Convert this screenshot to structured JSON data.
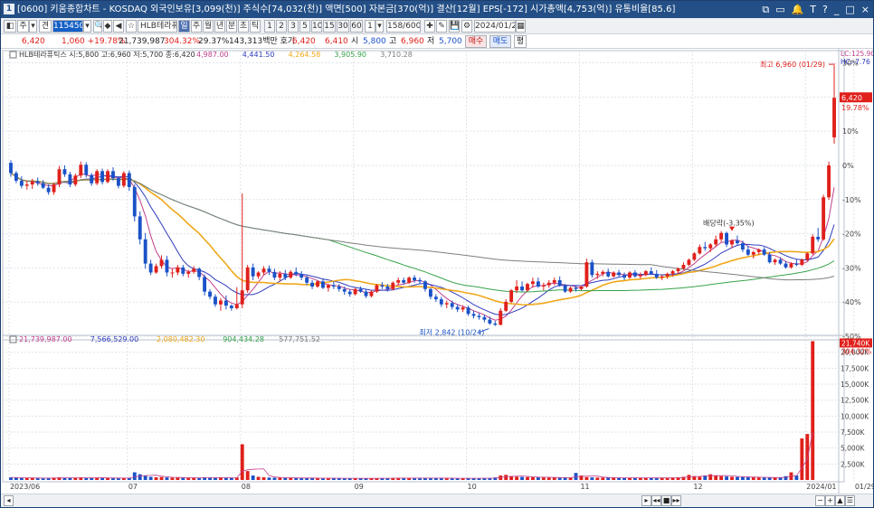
{
  "window": {
    "number": "1",
    "title": "[0600] 키움종합차트 - KOSDAQ 외국인보유[3,099(천)] 주식수[74,032(천)] 액면[500] 자본금[370(억)] 결산[12월] EPS[-172] 시가총액[4,753(억)] 유통비율[85.6]",
    "controls": [
      "⧉",
      "▭",
      "🔔",
      "T",
      "?",
      "_",
      "□",
      "×"
    ]
  },
  "toolbar": {
    "toggle": "◧",
    "market": "주",
    "dropdown": "▾",
    "search_type": "견",
    "stock_code": "115450",
    "search_icon": "🔍",
    "lock_icon": "◆",
    "prev_icon": "◀",
    "star_icon": "☆",
    "stock_name": "HLB테라퓨",
    "periods": [
      "일",
      "주",
      "월",
      "년",
      "분",
      "초",
      "틱"
    ],
    "intervals": [
      "1",
      "2",
      "3",
      "5",
      "10",
      "15",
      "30",
      "60"
    ],
    "interval_value": "1",
    "count": "158/600",
    "tool_icons": [
      "✚",
      "✎",
      "💾",
      "⚙"
    ],
    "date": "2024/01/29",
    "calendar_icon": "▦"
  },
  "quote": {
    "price": "6,420",
    "change": "1,060 +19.78%",
    "volume": "21,739,987",
    "volume_ratio": "304.32%",
    "turnover": "29.37%",
    "trading_value": "143,313백만 호가",
    "ask": "6,420",
    "bid": "6,410",
    "open_label": "시",
    "open": "5,800",
    "high_label": "고",
    "high": "6,960",
    "low_label": "저",
    "low": "5,700",
    "buy_label": "매수",
    "sell_label": "매도",
    "equal_label": "평"
  },
  "legend": {
    "price": "HLB테라퓨틱스 시:5,800 고:6,960 저:5,700 종:6,420",
    "ma_values": [
      "4,987.00",
      "4,441.50",
      "4,264.58",
      "3,905.90",
      "3,710.28"
    ],
    "volume_values": [
      "21,739,987.00",
      "7,566,529.00",
      "2,080,482.30",
      "904,434.28",
      "577,751.52"
    ]
  },
  "colors": {
    "up": "#e0201b",
    "down": "#1a52c8",
    "ma5": "#c0408c",
    "ma10": "#2f3cbf",
    "ma20": "#f0a81b",
    "ma60": "#36a34a",
    "ma120": "#7e7e7e",
    "grid": "#dde3ea",
    "window": "#234f86"
  },
  "axis": {
    "corner_top": "LC:125.90",
    "corner_sub": "HC:-7.76",
    "price_flag": "6,420",
    "price_flag_pct": "19.78%",
    "vol_flag": "21,740K",
    "vol_flag_pct": "304.32%"
  },
  "annotations": {
    "high": "최고 6,960 (01/29)",
    "low": "최저 2,842 (10/24)",
    "ex_dividend": "배당락(-3.35%)"
  },
  "bottom": {
    "scroll_left": "◂",
    "nav": [
      "▸",
      "◂◂",
      "■",
      "▸▸"
    ],
    "zoom": [
      "−",
      "+",
      "▲",
      "☰"
    ],
    "last_date": "01/29"
  },
  "chart_data": {
    "type": "candlestick",
    "price_axis": {
      "labels": [
        "30%",
        "20%",
        "10%",
        "0%",
        "-10%",
        "-20%",
        "-30%",
        "-40%",
        "-50%"
      ],
      "values": [
        30,
        20,
        10,
        0,
        -10,
        -20,
        -30,
        -40,
        -50
      ],
      "reference_price": 5360
    },
    "volume_axis": {
      "labels": [
        "20,000K",
        "17,500K",
        "15,000K",
        "12,500K",
        "10,000K",
        "7,500K",
        "5,000K",
        "2,500K"
      ],
      "values": [
        20000,
        17500,
        15000,
        12500,
        10000,
        7500,
        5000,
        2500
      ],
      "unit": "K"
    },
    "date_labels": [
      "2023/06",
      "07",
      "08",
      "09",
      "10",
      "11",
      "12",
      "2024/01",
      "01/29"
    ],
    "date_label_index": [
      0,
      22,
      43,
      64,
      85,
      106,
      127,
      148,
      157
    ],
    "candles": [
      [
        5400,
        5440,
        5180,
        5240
      ],
      [
        5240,
        5270,
        5080,
        5120
      ],
      [
        5120,
        5190,
        5000,
        5040
      ],
      [
        5040,
        5120,
        4980,
        5060
      ],
      [
        5060,
        5150,
        4990,
        5110
      ],
      [
        5110,
        5170,
        5040,
        5080
      ],
      [
        5080,
        5130,
        4990,
        5010
      ],
      [
        5010,
        5060,
        4900,
        4940
      ],
      [
        4940,
        5090,
        4900,
        5060
      ],
      [
        5060,
        5350,
        5020,
        5300
      ],
      [
        5300,
        5360,
        5180,
        5220
      ],
      [
        5220,
        5260,
        5020,
        5060
      ],
      [
        5060,
        5230,
        5030,
        5200
      ],
      [
        5200,
        5420,
        5160,
        5370
      ],
      [
        5370,
        5410,
        5170,
        5210
      ],
      [
        5210,
        5240,
        5040,
        5080
      ],
      [
        5080,
        5300,
        5050,
        5270
      ],
      [
        5270,
        5310,
        5060,
        5100
      ],
      [
        5100,
        5300,
        5080,
        5270
      ],
      [
        5270,
        5330,
        5120,
        5160
      ],
      [
        5160,
        5190,
        5000,
        5040
      ],
      [
        5040,
        5270,
        5010,
        5240
      ],
      [
        5240,
        5280,
        4960,
        5020
      ],
      [
        5020,
        5060,
        4480,
        4560
      ],
      [
        4560,
        4640,
        4120,
        4200
      ],
      [
        4200,
        4300,
        3740,
        3820
      ],
      [
        3820,
        3880,
        3640,
        3680
      ],
      [
        3680,
        3820,
        3660,
        3780
      ],
      [
        3780,
        3950,
        3740,
        3880
      ],
      [
        3880,
        3940,
        3620,
        3680
      ],
      [
        3680,
        3740,
        3600,
        3680
      ],
      [
        3680,
        3800,
        3640,
        3760
      ],
      [
        3760,
        3800,
        3620,
        3660
      ],
      [
        3660,
        3720,
        3600,
        3690
      ],
      [
        3690,
        3780,
        3660,
        3740
      ],
      [
        3740,
        3760,
        3560,
        3610
      ],
      [
        3610,
        3650,
        3320,
        3380
      ],
      [
        3380,
        3420,
        3260,
        3300
      ],
      [
        3300,
        3340,
        3140,
        3180
      ],
      [
        3180,
        3280,
        3080,
        3240
      ],
      [
        3240,
        3320,
        3100,
        3160
      ],
      [
        3160,
        3180,
        3080,
        3120
      ],
      [
        3120,
        3450,
        3100,
        3180
      ],
      [
        3180,
        4920,
        3120,
        3400
      ],
      [
        3400,
        3800,
        3360,
        3760
      ],
      [
        3760,
        3820,
        3560,
        3620
      ],
      [
        3620,
        3700,
        3580,
        3680
      ],
      [
        3680,
        3780,
        3640,
        3740
      ],
      [
        3740,
        3790,
        3640,
        3690
      ],
      [
        3690,
        3740,
        3560,
        3600
      ],
      [
        3600,
        3700,
        3540,
        3660
      ],
      [
        3660,
        3720,
        3560,
        3600
      ],
      [
        3600,
        3720,
        3580,
        3690
      ],
      [
        3690,
        3760,
        3620,
        3650
      ],
      [
        3650,
        3700,
        3560,
        3600
      ],
      [
        3600,
        3630,
        3480,
        3520
      ],
      [
        3520,
        3560,
        3420,
        3460
      ],
      [
        3460,
        3560,
        3440,
        3540
      ],
      [
        3540,
        3590,
        3420,
        3440
      ],
      [
        3440,
        3500,
        3380,
        3480
      ],
      [
        3480,
        3540,
        3420,
        3460
      ],
      [
        3460,
        3500,
        3380,
        3420
      ],
      [
        3420,
        3460,
        3330,
        3380
      ],
      [
        3380,
        3420,
        3300,
        3340
      ],
      [
        3340,
        3440,
        3320,
        3420
      ],
      [
        3420,
        3460,
        3360,
        3380
      ],
      [
        3380,
        3410,
        3280,
        3310
      ],
      [
        3310,
        3400,
        3290,
        3380
      ],
      [
        3380,
        3500,
        3360,
        3480
      ],
      [
        3480,
        3530,
        3420,
        3460
      ],
      [
        3460,
        3500,
        3380,
        3420
      ],
      [
        3420,
        3540,
        3400,
        3520
      ],
      [
        3520,
        3600,
        3480,
        3560
      ],
      [
        3560,
        3600,
        3490,
        3520
      ],
      [
        3520,
        3620,
        3500,
        3600
      ],
      [
        3600,
        3640,
        3520,
        3560
      ],
      [
        3560,
        3600,
        3500,
        3540
      ],
      [
        3540,
        3560,
        3380,
        3420
      ],
      [
        3420,
        3440,
        3260,
        3300
      ],
      [
        3300,
        3340,
        3220,
        3260
      ],
      [
        3260,
        3300,
        3140,
        3180
      ],
      [
        3180,
        3240,
        3120,
        3200
      ],
      [
        3200,
        3240,
        3100,
        3140
      ],
      [
        3140,
        3180,
        3060,
        3100
      ],
      [
        3100,
        3160,
        3060,
        3130
      ],
      [
        3130,
        3160,
        3000,
        3030
      ],
      [
        3030,
        3080,
        2960,
        3000
      ],
      [
        3000,
        3040,
        2940,
        2980
      ],
      [
        2980,
        3020,
        2900,
        2940
      ],
      [
        2940,
        2990,
        2860,
        2880
      ],
      [
        2880,
        2920,
        2842,
        2860
      ],
      [
        2860,
        3120,
        2850,
        3080
      ],
      [
        3080,
        3260,
        3060,
        3220
      ],
      [
        3220,
        3420,
        3200,
        3400
      ],
      [
        3400,
        3560,
        3360,
        3460
      ],
      [
        3460,
        3540,
        3380,
        3400
      ],
      [
        3400,
        3520,
        3380,
        3500
      ],
      [
        3500,
        3600,
        3440,
        3540
      ],
      [
        3540,
        3600,
        3440,
        3460
      ],
      [
        3460,
        3520,
        3400,
        3480
      ],
      [
        3480,
        3560,
        3440,
        3520
      ],
      [
        3520,
        3600,
        3480,
        3560
      ],
      [
        3560,
        3620,
        3460,
        3480
      ],
      [
        3480,
        3500,
        3360,
        3380
      ],
      [
        3380,
        3460,
        3360,
        3440
      ],
      [
        3440,
        3480,
        3380,
        3420
      ],
      [
        3420,
        3480,
        3400,
        3460
      ],
      [
        3460,
        3900,
        3440,
        3840
      ],
      [
        3840,
        3880,
        3600,
        3640
      ],
      [
        3640,
        3700,
        3580,
        3660
      ],
      [
        3660,
        3720,
        3620,
        3690
      ],
      [
        3690,
        3740,
        3600,
        3620
      ],
      [
        3620,
        3700,
        3600,
        3680
      ],
      [
        3680,
        3720,
        3620,
        3640
      ],
      [
        3640,
        3680,
        3560,
        3600
      ],
      [
        3600,
        3700,
        3580,
        3680
      ],
      [
        3680,
        3720,
        3600,
        3620
      ],
      [
        3620,
        3680,
        3580,
        3640
      ],
      [
        3640,
        3720,
        3620,
        3700
      ],
      [
        3700,
        3760,
        3640,
        3660
      ],
      [
        3660,
        3720,
        3580,
        3600
      ],
      [
        3600,
        3640,
        3560,
        3620
      ],
      [
        3620,
        3680,
        3580,
        3660
      ],
      [
        3660,
        3720,
        3620,
        3700
      ],
      [
        3700,
        3760,
        3660,
        3740
      ],
      [
        3740,
        3840,
        3720,
        3800
      ],
      [
        3800,
        3900,
        3780,
        3880
      ],
      [
        3880,
        4000,
        3860,
        3980
      ],
      [
        3980,
        4120,
        3960,
        4080
      ],
      [
        4080,
        4160,
        4020,
        4060
      ],
      [
        4060,
        4140,
        4000,
        4120
      ],
      [
        4120,
        4260,
        4080,
        4200
      ],
      [
        4200,
        4330,
        4160,
        4300
      ],
      [
        4300,
        4320,
        4080,
        4120
      ],
      [
        4120,
        4200,
        4060,
        4180
      ],
      [
        4180,
        4260,
        4100,
        4140
      ],
      [
        4140,
        4180,
        4000,
        4040
      ],
      [
        4040,
        4100,
        3940,
        3960
      ],
      [
        3960,
        4020,
        3900,
        4000
      ],
      [
        4000,
        4060,
        3960,
        4040
      ],
      [
        4040,
        4080,
        3940,
        3960
      ],
      [
        3960,
        4000,
        3820,
        3840
      ],
      [
        3840,
        3900,
        3800,
        3880
      ],
      [
        3880,
        3920,
        3800,
        3820
      ],
      [
        3820,
        3860,
        3740,
        3760
      ],
      [
        3760,
        3840,
        3740,
        3820
      ],
      [
        3820,
        3880,
        3780,
        3800
      ],
      [
        3800,
        3900,
        3780,
        3880
      ],
      [
        3880,
        4000,
        3860,
        3980
      ],
      [
        3980,
        4280,
        3960,
        4240
      ],
      [
        4240,
        4380,
        4160,
        4200
      ],
      [
        4200,
        4900,
        4180,
        4860
      ],
      [
        4860,
        5420,
        4820,
        5360
      ],
      [
        5800,
        6960,
        5700,
        6420
      ]
    ],
    "volumes": [
      400,
      350,
      300,
      320,
      300,
      280,
      260,
      300,
      380,
      420,
      350,
      300,
      300,
      400,
      350,
      300,
      380,
      320,
      300,
      280,
      260,
      340,
      300,
      1200,
      900,
      700,
      500,
      420,
      460,
      400,
      360,
      380,
      340,
      320,
      350,
      300,
      420,
      380,
      350,
      360,
      320,
      300,
      380,
      5600,
      1400,
      700,
      500,
      420,
      380,
      360,
      340,
      320,
      340,
      300,
      290,
      310,
      300,
      280,
      260,
      280,
      300,
      280,
      260,
      250,
      270,
      260,
      240,
      250,
      280,
      300,
      270,
      290,
      320,
      300,
      310,
      280,
      270,
      300,
      330,
      290,
      280,
      260,
      270,
      260,
      280,
      300,
      270,
      260,
      280,
      300,
      400,
      700,
      800,
      600,
      500,
      480,
      460,
      440,
      420,
      400,
      380,
      360,
      340,
      350,
      360,
      1100,
      700,
      450,
      400,
      380,
      370,
      360,
      340,
      330,
      320,
      330,
      340,
      350,
      330,
      320,
      310,
      330,
      350,
      380,
      420,
      500,
      800,
      600,
      500,
      700,
      900,
      700,
      600,
      550,
      500,
      480,
      460,
      440,
      420,
      400,
      380,
      360,
      380,
      420,
      600,
      1200,
      700,
      6500,
      7200,
      21740
    ]
  }
}
